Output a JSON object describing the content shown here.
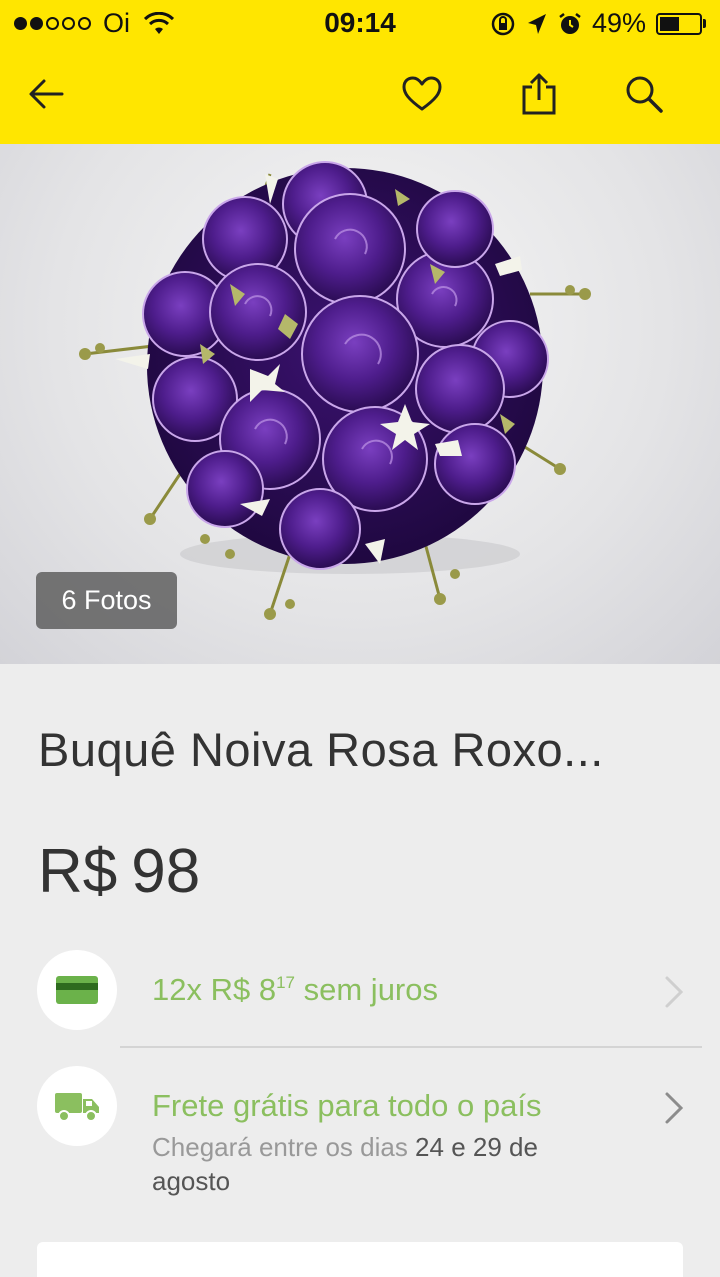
{
  "status_bar": {
    "carrier": "Oi",
    "time": "09:14",
    "battery": "49%",
    "battery_level": 0.49
  },
  "nav": {
    "back_icon": "arrow-left-icon",
    "favorite_icon": "heart-icon",
    "share_icon": "share-icon",
    "search_icon": "search-icon"
  },
  "gallery": {
    "photo_count": "6 Fotos"
  },
  "product": {
    "title": "Buquê Noiva Rosa Roxo...",
    "currency": "R$",
    "price": "98"
  },
  "installments": {
    "prefix": "12x R$ ",
    "amount": "8",
    "cents": "17",
    "suffix": " sem juros"
  },
  "shipping": {
    "title": "Frete grátis para todo o país",
    "eta_prefix": "Chegará entre os dias ",
    "day_from": "24",
    "eta_and": " e ",
    "day_to": "29",
    "eta_de": " de",
    "month": "agosto"
  },
  "colors": {
    "brand_yellow": "#ffe600",
    "accent_green": "#8bbf5f",
    "flower_purple": "#4a1a80"
  }
}
